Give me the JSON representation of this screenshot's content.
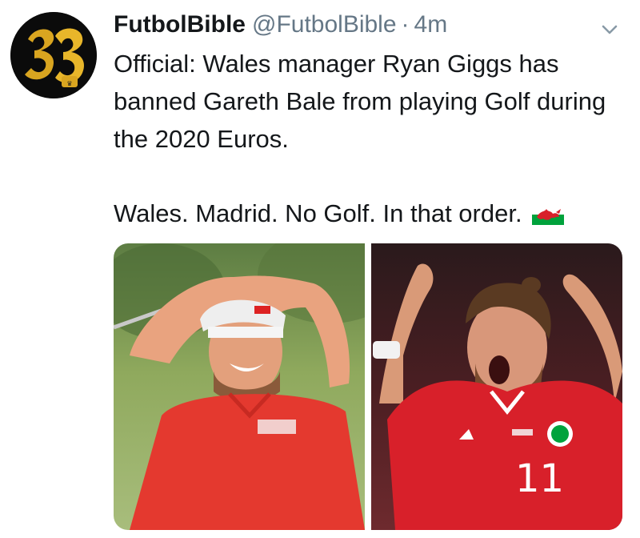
{
  "tweet": {
    "author": {
      "display_name": "FutbolBible",
      "handle": "@FutbolBible",
      "avatar_icon": "futbolbible-logo-icon"
    },
    "separator": "·",
    "timestamp": "4m",
    "menu_icon": "chevron-down-icon",
    "text_paragraph_1": "Official: Wales manager Ryan Giggs has banned Gareth Bale from playing Golf during the 2020 Euros.",
    "text_paragraph_2": "Wales. Madrid. No Golf. In that order.",
    "emoji": "wales-flag-icon",
    "media": {
      "images": [
        {
          "name": "golf-photo",
          "jersey_number": ""
        },
        {
          "name": "football-photo",
          "jersey_number": "11"
        }
      ]
    }
  },
  "colors": {
    "text": "#14171a",
    "secondary": "#657786",
    "wales_red": "#d8202a",
    "wales_green": "#00a23c"
  }
}
